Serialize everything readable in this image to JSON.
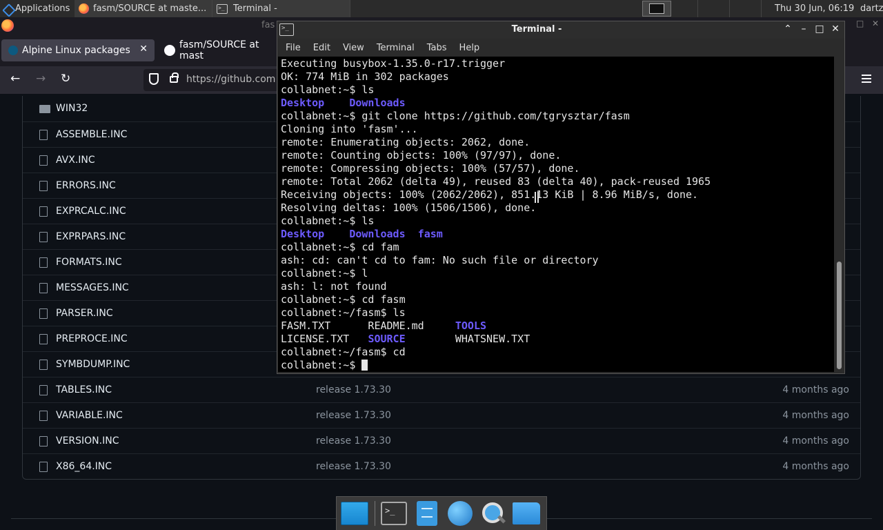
{
  "panel": {
    "applications": "Applications",
    "tasks": [
      {
        "label": "fasm/SOURCE at maste..."
      },
      {
        "label": "Terminal -"
      }
    ],
    "clock": "Thu 30 Jun, 06:19",
    "user": "dartz"
  },
  "firefox": {
    "title_fragment": "fas",
    "tabs": [
      {
        "label": "Alpine Linux packages"
      },
      {
        "label": "fasm/SOURCE at mast"
      }
    ],
    "url": "https://github.com",
    "files": [
      {
        "name": "WIN32",
        "type": "folder",
        "message": "",
        "date": ""
      },
      {
        "name": "ASSEMBLE.INC",
        "type": "file",
        "message": "",
        "date": ""
      },
      {
        "name": "AVX.INC",
        "type": "file",
        "message": "",
        "date": ""
      },
      {
        "name": "ERRORS.INC",
        "type": "file",
        "message": "",
        "date": ""
      },
      {
        "name": "EXPRCALC.INC",
        "type": "file",
        "message": "",
        "date": ""
      },
      {
        "name": "EXPRPARS.INC",
        "type": "file",
        "message": "",
        "date": ""
      },
      {
        "name": "FORMATS.INC",
        "type": "file",
        "message": "",
        "date": ""
      },
      {
        "name": "MESSAGES.INC",
        "type": "file",
        "message": "",
        "date": ""
      },
      {
        "name": "PARSER.INC",
        "type": "file",
        "message": "",
        "date": ""
      },
      {
        "name": "PREPROCE.INC",
        "type": "file",
        "message": "",
        "date": ""
      },
      {
        "name": "SYMBDUMP.INC",
        "type": "file",
        "message": "",
        "date": ""
      },
      {
        "name": "TABLES.INC",
        "type": "file",
        "message": "release 1.73.30",
        "date": "4 months ago"
      },
      {
        "name": "VARIABLE.INC",
        "type": "file",
        "message": "release 1.73.30",
        "date": "4 months ago"
      },
      {
        "name": "VERSION.INC",
        "type": "file",
        "message": "release 1.73.30",
        "date": "4 months ago"
      },
      {
        "name": "X86_64.INC",
        "type": "file",
        "message": "release 1.73.30",
        "date": "4 months ago"
      }
    ]
  },
  "terminal": {
    "title": "Terminal -",
    "menu": [
      "File",
      "Edit",
      "View",
      "Terminal",
      "Tabs",
      "Help"
    ],
    "lines": [
      [
        {
          "t": "Executing busybox-1.35.0-r17.trigger"
        }
      ],
      [
        {
          "t": "OK: 774 MiB in 302 packages"
        }
      ],
      [
        {
          "t": "collabnet:~$ ls"
        }
      ],
      [
        {
          "t": "Desktop",
          "dir": true
        },
        {
          "t": "    "
        },
        {
          "t": "Downloads",
          "dir": true
        }
      ],
      [
        {
          "t": "collabnet:~$ git clone https://github.com/tgrysztar/fasm"
        }
      ],
      [
        {
          "t": "Cloning into 'fasm'..."
        }
      ],
      [
        {
          "t": "remote: Enumerating objects: 2062, done."
        }
      ],
      [
        {
          "t": "remote: Counting objects: 100% (97/97), done."
        }
      ],
      [
        {
          "t": "remote: Compressing objects: 100% (57/57), done."
        }
      ],
      [
        {
          "t": "remote: Total 2062 (delta 49), reused 83 (delta 40), pack-reused 1965"
        }
      ],
      [
        {
          "t": "Receiving objects: 100% (2062/2062), 851.13 KiB | 8.96 MiB/s, done."
        }
      ],
      [
        {
          "t": "Resolving deltas: 100% (1506/1506), done."
        }
      ],
      [
        {
          "t": "collabnet:~$ ls"
        }
      ],
      [
        {
          "t": "Desktop",
          "dir": true
        },
        {
          "t": "    "
        },
        {
          "t": "Downloads",
          "dir": true
        },
        {
          "t": "  "
        },
        {
          "t": "fasm",
          "dir": true
        }
      ],
      [
        {
          "t": "collabnet:~$ cd fam"
        }
      ],
      [
        {
          "t": "ash: cd: can't cd to fam: No such file or directory"
        }
      ],
      [
        {
          "t": "collabnet:~$ l"
        }
      ],
      [
        {
          "t": "ash: l: not found"
        }
      ],
      [
        {
          "t": "collabnet:~$ cd fasm"
        }
      ],
      [
        {
          "t": "collabnet:~/fasm$ ls"
        }
      ],
      [
        {
          "t": "FASM.TXT      README.md     "
        },
        {
          "t": "TOOLS",
          "dir": true
        }
      ],
      [
        {
          "t": "LICENSE.TXT   "
        },
        {
          "t": "SOURCE",
          "dir": true
        },
        {
          "t": "        WHATSNEW.TXT"
        }
      ],
      [
        {
          "t": "collabnet:~/fasm$ cd"
        }
      ],
      [
        {
          "t": "collabnet:~$ "
        }
      ]
    ]
  },
  "dock": {
    "items": [
      {
        "name": "dock-show-desktop"
      },
      {
        "name": "dock-terminal"
      },
      {
        "name": "dock-file-manager"
      },
      {
        "name": "dock-web-browser"
      },
      {
        "name": "dock-app-finder"
      },
      {
        "name": "dock-home-folder"
      }
    ]
  },
  "colors": {
    "terminal_dir": "#6d5bff",
    "github_bg": "#0d1117",
    "panel_bg": "#2b2b2b"
  }
}
